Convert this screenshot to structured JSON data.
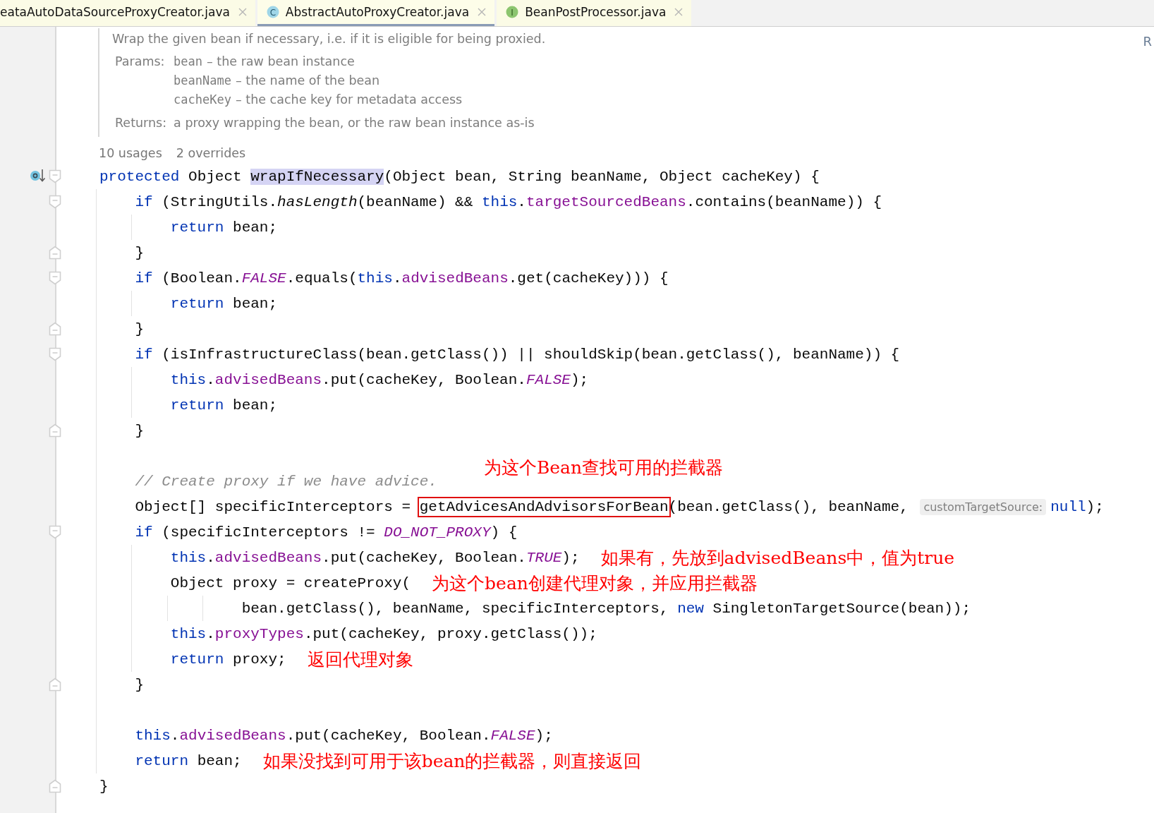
{
  "tabs": [
    {
      "label": "eataAutoDataSourceProxyCreator.java",
      "kind": "plain",
      "selected": false
    },
    {
      "label": "AbstractAutoProxyCreator.java",
      "kind": "class",
      "icon_text": "C",
      "selected": true
    },
    {
      "label": "BeanPostProcessor.java",
      "kind": "interface",
      "icon_text": "I",
      "selected": false
    }
  ],
  "right_edge_text": "R",
  "doc": {
    "summary": "Wrap the given bean if necessary, i.e. if it is eligible for being proxied.",
    "params_label": "Params:",
    "params": [
      {
        "name": "bean",
        "description": "– the raw bean instance"
      },
      {
        "name": "beanName",
        "description": "– the name of the bean"
      },
      {
        "name": "cacheKey",
        "description": "– the cache key for metadata access"
      }
    ],
    "returns_label": "Returns:",
    "returns": "a proxy wrapping the bean, or the raw bean instance as-is"
  },
  "usages": [
    "10 usages",
    "2 overrides"
  ],
  "lines": [
    {
      "kind": "code",
      "override_marker": true,
      "fold_start": true,
      "fold_end": false,
      "tokens": [
        {
          "kind": "keyword",
          "text": "protected"
        },
        {
          "kind": "plain",
          "text": " Object "
        },
        {
          "kind": "method",
          "text": "wrapIfNecessary",
          "highlighted": true
        },
        {
          "kind": "plain",
          "text": "(Object bean, String beanName, Object cacheKey) {"
        }
      ]
    },
    {
      "kind": "code",
      "override_marker": false,
      "fold_start": true,
      "fold_end": false,
      "tokens": [
        {
          "kind": "keyword",
          "text": "    if"
        },
        {
          "kind": "plain",
          "text": " (StringUtils."
        },
        {
          "kind": "static_method",
          "text": "hasLength"
        },
        {
          "kind": "plain",
          "text": "(beanName) && "
        },
        {
          "kind": "keyword",
          "text": "this"
        },
        {
          "kind": "plain",
          "text": "."
        },
        {
          "kind": "field",
          "text": "targetSourcedBeans"
        },
        {
          "kind": "plain",
          "text": ".contains(beanName)) {"
        }
      ]
    },
    {
      "kind": "code",
      "override_marker": false,
      "fold_start": false,
      "fold_end": false,
      "tokens": [
        {
          "kind": "keyword",
          "text": "        return"
        },
        {
          "kind": "plain",
          "text": " bean;"
        }
      ]
    },
    {
      "kind": "code",
      "override_marker": false,
      "fold_start": false,
      "fold_end": true,
      "tokens": [
        {
          "kind": "plain",
          "text": "    }"
        }
      ]
    },
    {
      "kind": "code",
      "override_marker": false,
      "fold_start": true,
      "fold_end": false,
      "tokens": [
        {
          "kind": "keyword",
          "text": "    if"
        },
        {
          "kind": "plain",
          "text": " (Boolean."
        },
        {
          "kind": "static_field",
          "text": "FALSE"
        },
        {
          "kind": "plain",
          "text": ".equals("
        },
        {
          "kind": "keyword",
          "text": "this"
        },
        {
          "kind": "plain",
          "text": "."
        },
        {
          "kind": "field",
          "text": "advisedBeans"
        },
        {
          "kind": "plain",
          "text": ".get(cacheKey))) {"
        }
      ]
    },
    {
      "kind": "code",
      "override_marker": false,
      "fold_start": false,
      "fold_end": false,
      "tokens": [
        {
          "kind": "keyword",
          "text": "        return"
        },
        {
          "kind": "plain",
          "text": " bean;"
        }
      ]
    },
    {
      "kind": "code",
      "override_marker": false,
      "fold_start": false,
      "fold_end": true,
      "tokens": [
        {
          "kind": "plain",
          "text": "    }"
        }
      ]
    },
    {
      "kind": "code",
      "override_marker": false,
      "fold_start": true,
      "fold_end": false,
      "tokens": [
        {
          "kind": "keyword",
          "text": "    if"
        },
        {
          "kind": "plain",
          "text": " (isInfrastructureClass(bean.getClass()) || shouldSkip(bean.getClass(), beanName)) {"
        }
      ]
    },
    {
      "kind": "code",
      "override_marker": false,
      "fold_start": false,
      "fold_end": false,
      "tokens": [
        {
          "kind": "keyword",
          "text": "        this"
        },
        {
          "kind": "plain",
          "text": "."
        },
        {
          "kind": "field",
          "text": "advisedBeans"
        },
        {
          "kind": "plain",
          "text": ".put(cacheKey, Boolean."
        },
        {
          "kind": "static_field",
          "text": "FALSE"
        },
        {
          "kind": "plain",
          "text": ");"
        }
      ]
    },
    {
      "kind": "code",
      "override_marker": false,
      "fold_start": false,
      "fold_end": false,
      "tokens": [
        {
          "kind": "keyword",
          "text": "        return"
        },
        {
          "kind": "plain",
          "text": " bean;"
        }
      ]
    },
    {
      "kind": "code",
      "override_marker": false,
      "fold_start": false,
      "fold_end": true,
      "tokens": [
        {
          "kind": "plain",
          "text": "    }"
        }
      ]
    },
    {
      "kind": "blank"
    },
    {
      "kind": "code",
      "override_marker": false,
      "fold_start": false,
      "fold_end": false,
      "tokens": [
        {
          "kind": "comment",
          "text": "    // Create proxy if we have advice."
        },
        {
          "kind": "note",
          "text": "为这个Bean查找可用的拦截器"
        }
      ]
    },
    {
      "kind": "code",
      "override_marker": false,
      "fold_start": false,
      "fold_end": false,
      "tokens": [
        {
          "kind": "plain",
          "text": "    Object[] specificInterceptors = "
        },
        {
          "kind": "plain",
          "text": "getAdvicesAndAdvisorsForBean",
          "boxed": true
        },
        {
          "kind": "plain",
          "text": "(bean.getClass(), beanName, "
        },
        {
          "kind": "hint",
          "text": "customTargetSource:"
        },
        {
          "kind": "keyword",
          "text": "null"
        },
        {
          "kind": "plain",
          "text": ");"
        }
      ]
    },
    {
      "kind": "code",
      "override_marker": false,
      "fold_start": true,
      "fold_end": false,
      "tokens": [
        {
          "kind": "keyword",
          "text": "    if"
        },
        {
          "kind": "plain",
          "text": " (specificInterceptors != "
        },
        {
          "kind": "static_field",
          "text": "DO_NOT_PROXY"
        },
        {
          "kind": "plain",
          "text": ") {"
        }
      ]
    },
    {
      "kind": "code",
      "override_marker": false,
      "fold_start": false,
      "fold_end": false,
      "tokens": [
        {
          "kind": "keyword",
          "text": "        this"
        },
        {
          "kind": "plain",
          "text": "."
        },
        {
          "kind": "field",
          "text": "advisedBeans"
        },
        {
          "kind": "plain",
          "text": ".put(cacheKey, Boolean."
        },
        {
          "kind": "static_field",
          "text": "TRUE"
        },
        {
          "kind": "plain",
          "text": ");"
        },
        {
          "kind": "note",
          "text": "如果有，先放到advisedBeans中，值为true"
        }
      ]
    },
    {
      "kind": "code",
      "override_marker": false,
      "fold_start": false,
      "fold_end": false,
      "tokens": [
        {
          "kind": "plain",
          "text": "        Object proxy = createProxy("
        },
        {
          "kind": "note",
          "text": "为这个bean创建代理对象，并应用拦截器"
        }
      ]
    },
    {
      "kind": "code",
      "override_marker": false,
      "fold_start": false,
      "fold_end": false,
      "tokens": [
        {
          "kind": "plain",
          "text": "                bean.getClass(), beanName, specificInterceptors, "
        },
        {
          "kind": "keyword",
          "text": "new"
        },
        {
          "kind": "plain",
          "text": " SingletonTargetSource(bean));"
        }
      ]
    },
    {
      "kind": "code",
      "override_marker": false,
      "fold_start": false,
      "fold_end": false,
      "tokens": [
        {
          "kind": "keyword",
          "text": "        this"
        },
        {
          "kind": "plain",
          "text": "."
        },
        {
          "kind": "field",
          "text": "proxyTypes"
        },
        {
          "kind": "plain",
          "text": ".put(cacheKey, proxy.getClass());"
        }
      ]
    },
    {
      "kind": "code",
      "override_marker": false,
      "fold_start": false,
      "fold_end": false,
      "tokens": [
        {
          "kind": "keyword",
          "text": "        return"
        },
        {
          "kind": "plain",
          "text": " proxy;"
        },
        {
          "kind": "note",
          "text": "返回代理对象"
        }
      ]
    },
    {
      "kind": "code",
      "override_marker": false,
      "fold_start": false,
      "fold_end": true,
      "tokens": [
        {
          "kind": "plain",
          "text": "    }"
        }
      ]
    },
    {
      "kind": "blank"
    },
    {
      "kind": "code",
      "override_marker": false,
      "fold_start": false,
      "fold_end": false,
      "tokens": [
        {
          "kind": "keyword",
          "text": "    this"
        },
        {
          "kind": "plain",
          "text": "."
        },
        {
          "kind": "field",
          "text": "advisedBeans"
        },
        {
          "kind": "plain",
          "text": ".put(cacheKey, Boolean."
        },
        {
          "kind": "static_field",
          "text": "FALSE"
        },
        {
          "kind": "plain",
          "text": ");"
        }
      ]
    },
    {
      "kind": "code",
      "override_marker": false,
      "fold_start": false,
      "fold_end": false,
      "tokens": [
        {
          "kind": "keyword",
          "text": "    return"
        },
        {
          "kind": "plain",
          "text": " bean;"
        },
        {
          "kind": "note",
          "text": "如果没找到可用于该bean的拦截器，则直接返回"
        }
      ]
    },
    {
      "kind": "code",
      "override_marker": false,
      "fold_start": false,
      "fold_end": true,
      "tokens": [
        {
          "kind": "plain",
          "text": "}"
        }
      ]
    }
  ]
}
